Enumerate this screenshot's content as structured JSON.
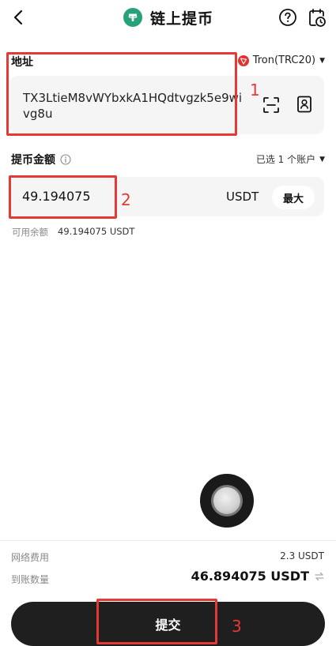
{
  "header": {
    "title": "链上提币",
    "back_icon": "chevron-left-icon",
    "help_icon": "question-circle-icon",
    "history_icon": "history-clock-icon"
  },
  "address": {
    "label": "地址",
    "network": "Tron(TRC20)",
    "value": "TX3LtieM8vWYbxkA1HQdtvgzk5e9wivg8u"
  },
  "amount": {
    "label": "提币金额",
    "account_select": "已选 1 个账户",
    "value": "49.194075",
    "unit": "USDT",
    "max_label": "最大",
    "available_label": "可用余额",
    "available_value": "49.194075 USDT"
  },
  "fees": {
    "network_fee_label": "网络费用",
    "network_fee_value": "2.3 USDT",
    "receive_label": "到账数量",
    "receive_value": "46.894075 USDT"
  },
  "submit_label": "提交",
  "annotations": [
    "1",
    "2",
    "3"
  ],
  "colors": {
    "tether": "#26a17b",
    "tron": "#e5312b",
    "annotation": "#e53935",
    "button": "#1f1f1f"
  }
}
